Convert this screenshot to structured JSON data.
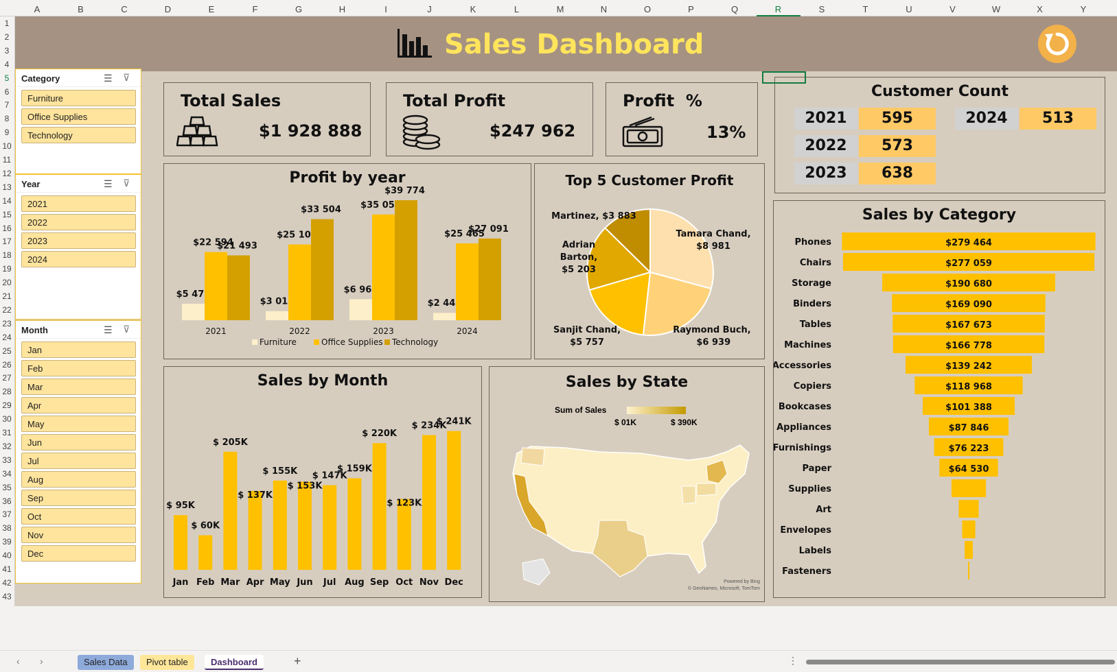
{
  "columns": [
    "A",
    "B",
    "C",
    "D",
    "E",
    "F",
    "G",
    "H",
    "I",
    "J",
    "K",
    "L",
    "M",
    "N",
    "O",
    "P",
    "Q",
    "R",
    "S",
    "T",
    "U",
    "V",
    "W",
    "X",
    "Y"
  ],
  "selected_column": "R",
  "rows": [
    "1",
    "2",
    "3",
    "4",
    "5",
    "6",
    "7",
    "8",
    "9",
    "10",
    "11",
    "12",
    "13",
    "14",
    "15",
    "16",
    "17",
    "18",
    "19",
    "20",
    "21",
    "22",
    "23",
    "24",
    "25",
    "26",
    "27",
    "28",
    "29",
    "30",
    "31",
    "32",
    "33",
    "34",
    "35",
    "36",
    "37",
    "38",
    "39",
    "40",
    "41",
    "42",
    "43"
  ],
  "selected_row": "5",
  "banner": {
    "title": "Sales Dashboard",
    "background": "#a59282",
    "title_color": "#ffe45c",
    "refresh_icon": "refresh-icon"
  },
  "slicers": {
    "category": {
      "title": "Category",
      "items": [
        "Furniture",
        "Office Supplies",
        "Technology"
      ]
    },
    "year": {
      "title": "Year",
      "items": [
        "2021",
        "2022",
        "2023",
        "2024"
      ]
    },
    "month": {
      "title": "Month",
      "items": [
        "Jan",
        "Feb",
        "Mar",
        "Apr",
        "May",
        "Jun",
        "Jul",
        "Aug",
        "Sep",
        "Oct",
        "Nov",
        "Dec"
      ]
    }
  },
  "kpis": {
    "total_sales": {
      "label": "Total Sales",
      "value": "$1 928 888"
    },
    "total_profit": {
      "label": "Total Profit",
      "value": "$247 962"
    },
    "profit_pct": {
      "label": "Profit  %",
      "value": "13%"
    }
  },
  "customer_count": {
    "title": "Customer Count",
    "entries": [
      {
        "year": "2021",
        "count": "595"
      },
      {
        "year": "2022",
        "count": "573"
      },
      {
        "year": "2023",
        "count": "638"
      },
      {
        "year": "2024",
        "count": "513"
      }
    ]
  },
  "chart_data": [
    {
      "id": "profit_by_year",
      "type": "bar",
      "title": "Profit by year",
      "categories": [
        "2021",
        "2022",
        "2023",
        "2024"
      ],
      "series": [
        {
          "name": "Furniture",
          "values": [
            5470,
            3015,
            6960,
            2444
          ],
          "labels": [
            "$5 470",
            "$3 015",
            "$6 960",
            "$2 444"
          ],
          "color": "#fdefc9"
        },
        {
          "name": "Office Supplies",
          "values": [
            22594,
            25100,
            35053,
            25465
          ],
          "labels": [
            "$22 594",
            "$25 100",
            "$35 053",
            "$25 465"
          ],
          "color": "#ffc000"
        },
        {
          "name": "Technology",
          "values": [
            21493,
            33504,
            39774,
            27091
          ],
          "labels": [
            "$21 493",
            "$33 504",
            "$39 774",
            "$27 091"
          ],
          "color": "#d4a000"
        }
      ],
      "ylim": [
        0,
        40000
      ],
      "legend": "bottom",
      "grid": false
    },
    {
      "id": "top5_customer_profit",
      "type": "pie",
      "title": "Top 5 Customer Profit",
      "categories": [
        "Tamara Chand",
        "Raymond Buch",
        "Sanjit Chand",
        "Adrian Barton",
        "Martinez"
      ],
      "values": [
        8981,
        6939,
        5757,
        5203,
        3883
      ],
      "labels": [
        "Tamara Chand, $8 981",
        "Raymond Buch,  $6 939",
        "Sanjit Chand, $5 757",
        "Adrian Barton, $5 203",
        "Martinez,  $3 883"
      ],
      "colors": [
        "#fde0ae",
        "#ffd27a",
        "#ffc000",
        "#e0a800",
        "#c08c00"
      ]
    },
    {
      "id": "sales_by_month",
      "type": "bar",
      "title": "Sales by Month",
      "categories": [
        "Jan",
        "Feb",
        "Mar",
        "Apr",
        "May",
        "Jun",
        "Jul",
        "Aug",
        "Sep",
        "Oct",
        "Nov",
        "Dec"
      ],
      "values": [
        95,
        60,
        205,
        137,
        155,
        153,
        147,
        159,
        220,
        123,
        234,
        241
      ],
      "labels": [
        "$ 95K",
        "$ 60K",
        "$ 205K",
        "$ 137K",
        "$ 155K",
        "$ 153K",
        "$ 147K",
        "$ 159K",
        "$ 220K",
        "$ 123K",
        "$ 234K",
        "$ 241K"
      ],
      "units": "K",
      "color": "#ffc000",
      "ylim": [
        0,
        250
      ],
      "grid": false
    },
    {
      "id": "sales_by_state",
      "type": "map",
      "title": "Sales by State",
      "legend_title": "Sum of Sales",
      "legend_min": "$ 01K",
      "legend_max": "$ 390K",
      "credit1": "Powered by Bing",
      "credit2": "© GeoNames, Microsoft, TomTom"
    },
    {
      "id": "sales_by_category",
      "type": "bar",
      "orientation": "horizontal-funnel",
      "title": "Sales by Category",
      "categories": [
        "Phones",
        "Chairs",
        "Storage",
        "Binders",
        "Tables",
        "Machines",
        "Accessories",
        "Copiers",
        "Bookcases",
        "Appliances",
        "Furnishings",
        "Paper",
        "Supplies",
        "Art",
        "Envelopes",
        "Labels",
        "Fasteners"
      ],
      "values": [
        279464,
        277059,
        190680,
        169090,
        167673,
        166778,
        139242,
        118968,
        101388,
        87846,
        76223,
        64530,
        38000,
        22000,
        14500,
        9000,
        1500
      ],
      "labels": [
        "$279 464",
        "$277 059",
        "$190 680",
        "$169 090",
        "$167 673",
        "$166 778",
        "$139 242",
        "$118 968",
        "$101 388",
        "$87 846",
        "$76 223",
        "$64 530",
        "",
        "",
        "",
        "",
        ""
      ],
      "color": "#ffc000",
      "xlim": [
        0,
        280000
      ]
    }
  ],
  "tabs": [
    {
      "label": "Sales Data",
      "color": "#8eaadb"
    },
    {
      "label": "Pivot table",
      "color": "#ffe699"
    },
    {
      "label": "Dashboard",
      "active": true
    }
  ],
  "tab_icons": {
    "prev": "chevron-left-icon",
    "next": "chevron-right-icon",
    "add": "plus-icon",
    "more": "more-icon"
  }
}
